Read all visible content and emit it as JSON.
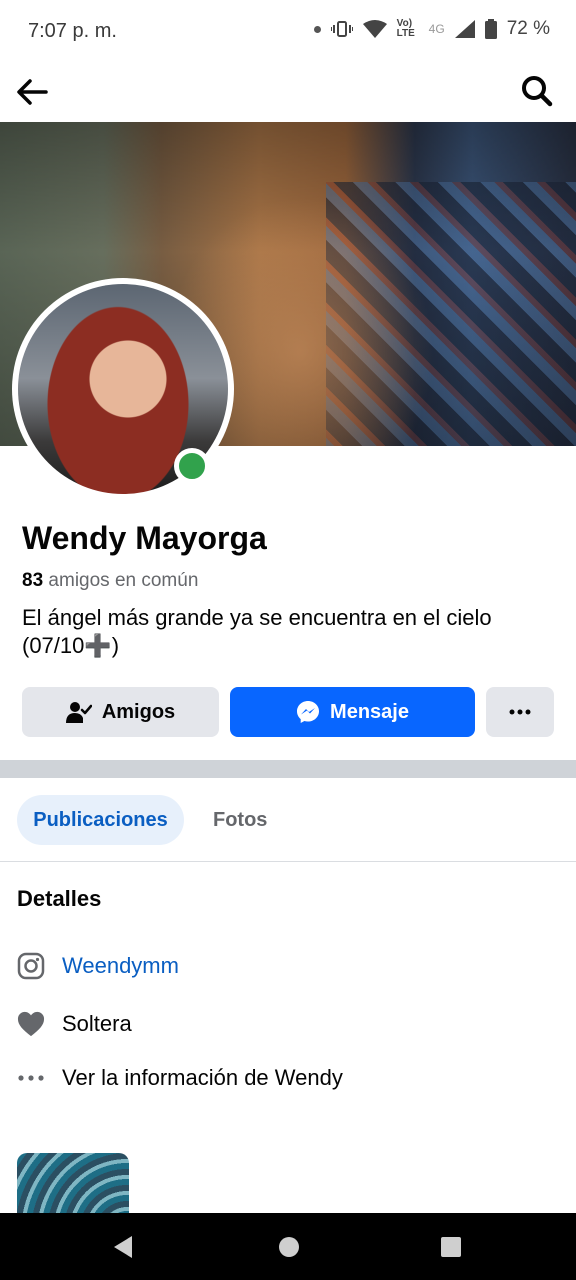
{
  "status_bar": {
    "time": "7:07 p. m.",
    "network_label": "Vo) LTE",
    "network_type": "4G",
    "battery": "72 %"
  },
  "top_bar": {
    "back_icon": "arrow-left-icon",
    "search_icon": "search-icon"
  },
  "profile": {
    "name": "Wendy Mayorga",
    "mutual_count": "83",
    "mutual_label": "amigos en común",
    "bio": "El ángel más grande ya se encuentra en el cielo (07/10➕)",
    "online": true
  },
  "actions": {
    "friends_label": "Amigos",
    "message_label": "Mensaje",
    "more_icon": "more-icon"
  },
  "tabs": [
    {
      "label": "Publicaciones",
      "active": true
    },
    {
      "label": "Fotos",
      "active": false
    }
  ],
  "details": {
    "title": "Detalles",
    "items": [
      {
        "icon": "instagram-icon",
        "text": "Weendymm"
      },
      {
        "icon": "heart-icon",
        "text": "Soltera"
      },
      {
        "icon": "ellipsis-icon",
        "text": "Ver la información de Wendy"
      }
    ]
  },
  "colors": {
    "primary": "#0866ff",
    "link": "#0a5ec2",
    "secondary_button": "#e4e6eb",
    "online": "#31a24c"
  }
}
